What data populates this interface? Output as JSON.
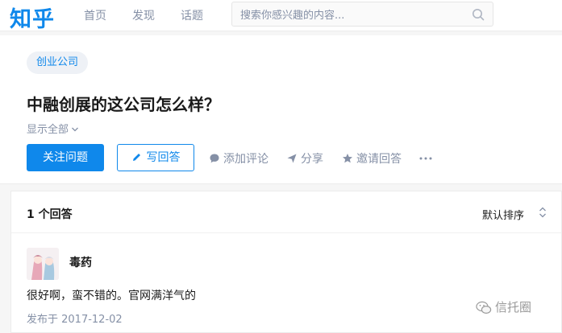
{
  "header": {
    "logo": "知乎",
    "nav": [
      "首页",
      "发现",
      "话题"
    ],
    "search_placeholder": "搜索你感兴趣的内容..."
  },
  "question": {
    "topic_tag": "创业公司",
    "title": "中融创展的这公司怎么样？",
    "show_all": "显示全部",
    "follow_label": "关注问题",
    "write_label": "写回答",
    "actions": [
      "添加评论",
      "分享",
      "邀请回答"
    ]
  },
  "answers": {
    "count_label": "1 个回答",
    "sort_label": "默认排序",
    "items": [
      {
        "author": "毒药",
        "content": "很好啊，蛮不错的。官网满洋气的",
        "published": "发布于 2017-12-02"
      }
    ]
  },
  "watermark": "信托圈",
  "colors": {
    "brand": "#0f88eb",
    "muted_text": "#8590a6",
    "page_bg": "#f6f6f6"
  },
  "icons": [
    "search-icon",
    "chevron-down-icon",
    "pencil-icon",
    "comment-icon",
    "share-icon",
    "star-icon",
    "more-icon",
    "sort-icon",
    "wechat-icon"
  ]
}
